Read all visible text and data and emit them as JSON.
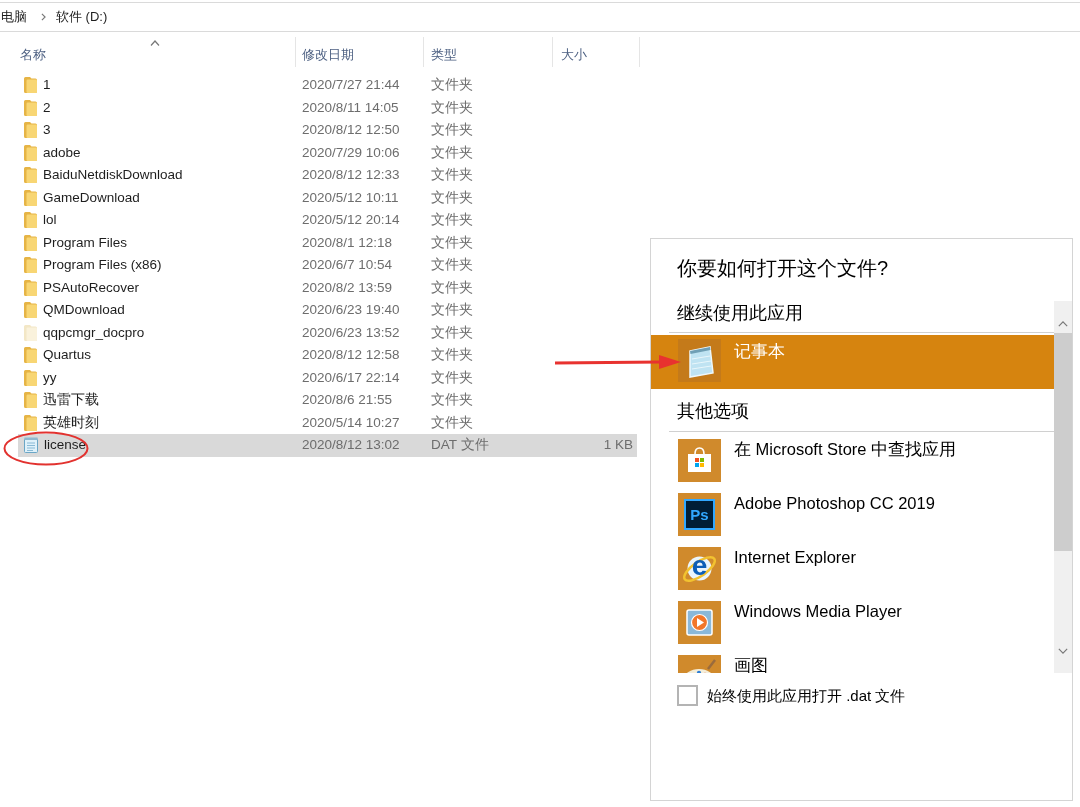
{
  "breadcrumb": {
    "items": [
      "电脑",
      "软件 (D:)"
    ]
  },
  "columns": [
    {
      "label": "名称",
      "sorted": true
    },
    {
      "label": "修改日期",
      "sorted": false
    },
    {
      "label": "类型",
      "sorted": false
    },
    {
      "label": "大小",
      "sorted": false
    }
  ],
  "files": [
    {
      "name": "1",
      "modified": "2020/7/27 21:44",
      "type": "文件夹",
      "kind": "folder",
      "hidden": false,
      "selected": false
    },
    {
      "name": "2",
      "modified": "2020/8/11 14:05",
      "type": "文件夹",
      "kind": "folder",
      "hidden": false,
      "selected": false
    },
    {
      "name": "3",
      "modified": "2020/8/12 12:50",
      "type": "文件夹",
      "kind": "folder",
      "hidden": false,
      "selected": false
    },
    {
      "name": "adobe",
      "modified": "2020/7/29 10:06",
      "type": "文件夹",
      "kind": "folder",
      "hidden": false,
      "selected": false
    },
    {
      "name": "BaiduNetdiskDownload",
      "modified": "2020/8/12 12:33",
      "type": "文件夹",
      "kind": "folder",
      "hidden": false,
      "selected": false
    },
    {
      "name": "GameDownload",
      "modified": "2020/5/12 10:11",
      "type": "文件夹",
      "kind": "folder",
      "hidden": false,
      "selected": false
    },
    {
      "name": "lol",
      "modified": "2020/5/12 20:14",
      "type": "文件夹",
      "kind": "folder",
      "hidden": false,
      "selected": false
    },
    {
      "name": "Program Files",
      "modified": "2020/8/1 12:18",
      "type": "文件夹",
      "kind": "folder",
      "hidden": false,
      "selected": false
    },
    {
      "name": "Program Files (x86)",
      "modified": "2020/6/7 10:54",
      "type": "文件夹",
      "kind": "folder",
      "hidden": false,
      "selected": false
    },
    {
      "name": "PSAutoRecover",
      "modified": "2020/8/2 13:59",
      "type": "文件夹",
      "kind": "folder",
      "hidden": false,
      "selected": false
    },
    {
      "name": "QMDownload",
      "modified": "2020/6/23 19:40",
      "type": "文件夹",
      "kind": "folder",
      "hidden": false,
      "selected": false
    },
    {
      "name": "qqpcmgr_docpro",
      "modified": "2020/6/23 13:52",
      "type": "文件夹",
      "kind": "folder",
      "hidden": true,
      "selected": false
    },
    {
      "name": "Quartus",
      "modified": "2020/8/12 12:58",
      "type": "文件夹",
      "kind": "folder",
      "hidden": false,
      "selected": false
    },
    {
      "name": "yy",
      "modified": "2020/6/17 22:14",
      "type": "文件夹",
      "kind": "folder",
      "hidden": false,
      "selected": false
    },
    {
      "name": "迅雷下载",
      "modified": "2020/8/6 21:55",
      "type": "文件夹",
      "kind": "folder",
      "hidden": false,
      "selected": false
    },
    {
      "name": "英雄时刻",
      "modified": "2020/5/14 10:27",
      "type": "文件夹",
      "kind": "folder",
      "hidden": false,
      "selected": false
    },
    {
      "name": "license",
      "modified": "2020/8/12 13:02",
      "type": "DAT 文件",
      "size": "1 KB",
      "kind": "file",
      "hidden": false,
      "selected": true
    }
  ],
  "open_with": {
    "title": "你要如何打开这个文件?",
    "current_heading": "继续使用此应用",
    "current_apps": [
      {
        "name": "记事本",
        "kind": "notepad",
        "selected": true
      }
    ],
    "other_heading": "其他选项",
    "other_apps": [
      {
        "name": "在 Microsoft Store 中查找应用",
        "kind": "store",
        "selected": false
      },
      {
        "name": "Adobe Photoshop CC 2019",
        "kind": "photoshop",
        "logo_text": "Ps",
        "selected": false
      },
      {
        "name": "Internet Explorer",
        "kind": "ie",
        "logo_text": "e",
        "selected": false
      },
      {
        "name": "Windows Media Player",
        "kind": "media_player",
        "selected": false
      },
      {
        "name": "画图",
        "kind": "paint",
        "selected": false
      }
    ],
    "always_use": {
      "label": "始终使用此应用打开 .dat 文件",
      "checked": false
    }
  }
}
